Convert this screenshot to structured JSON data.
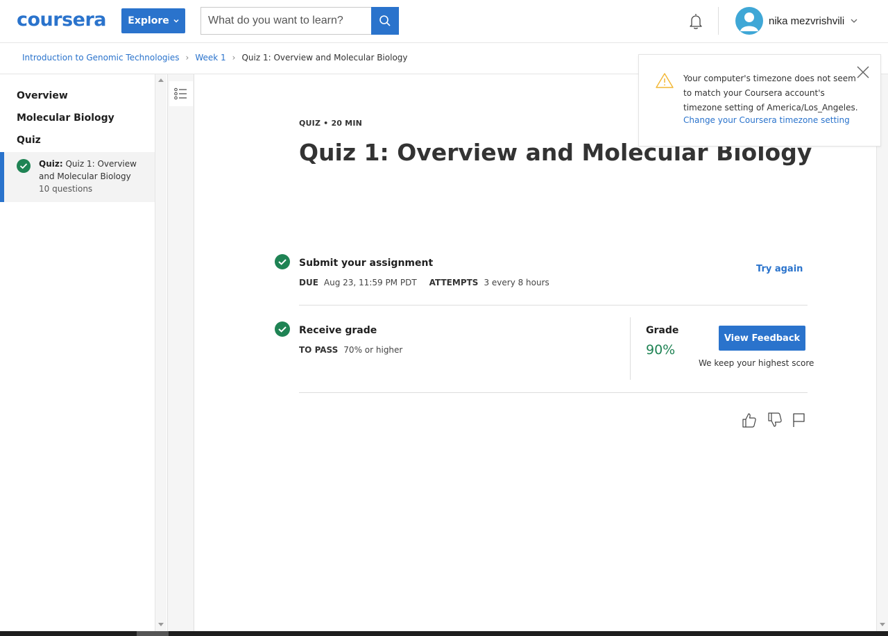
{
  "header": {
    "logo_text": "coursera",
    "explore_label": "Explore",
    "search_placeholder": "What do you want to learn?",
    "user_name": "nika mezvrishvili"
  },
  "breadcrumb": {
    "course": "Introduction to Genomic Technologies",
    "week": "Week 1",
    "current": "Quiz 1: Overview and Molecular Biology"
  },
  "sidebar": {
    "links": [
      "Overview",
      "Molecular Biology",
      "Quiz"
    ],
    "active_item": {
      "prefix": "Quiz:",
      "title": "Quiz 1: Overview and Molecular Biology",
      "subtitle": "10 questions"
    }
  },
  "main": {
    "meta": "QUIZ • 20 MIN",
    "title": "Quiz 1: Overview and Molecular Biology",
    "submit": {
      "title": "Submit your assignment",
      "due_label": "DUE",
      "due_value": "Aug 23, 11:59 PM PDT",
      "attempts_label": "ATTEMPTS",
      "attempts_value": "3 every 8 hours",
      "action": "Try again"
    },
    "grade": {
      "title": "Receive grade",
      "pass_label": "TO PASS",
      "pass_value": "70% or higher",
      "grade_label": "Grade",
      "grade_value": "90%",
      "button": "View Feedback",
      "note": "We keep your highest score"
    }
  },
  "notification": {
    "text": "Your computer's timezone does not seem to match your Coursera account's timezone setting of America/Los_Angeles.",
    "link": "Change your Coursera timezone setting"
  },
  "colors": {
    "brand_blue": "#2a73cc",
    "success_green": "#1f8354",
    "warning_yellow": "#f2b632"
  },
  "icons": {
    "search": "search-icon",
    "bell": "bell-icon",
    "check": "check-circle-icon",
    "like": "thumbs-up-icon",
    "dislike": "thumbs-down-icon",
    "flag": "flag-icon",
    "warning": "warning-icon",
    "close": "close-icon",
    "toc": "list-icon"
  }
}
